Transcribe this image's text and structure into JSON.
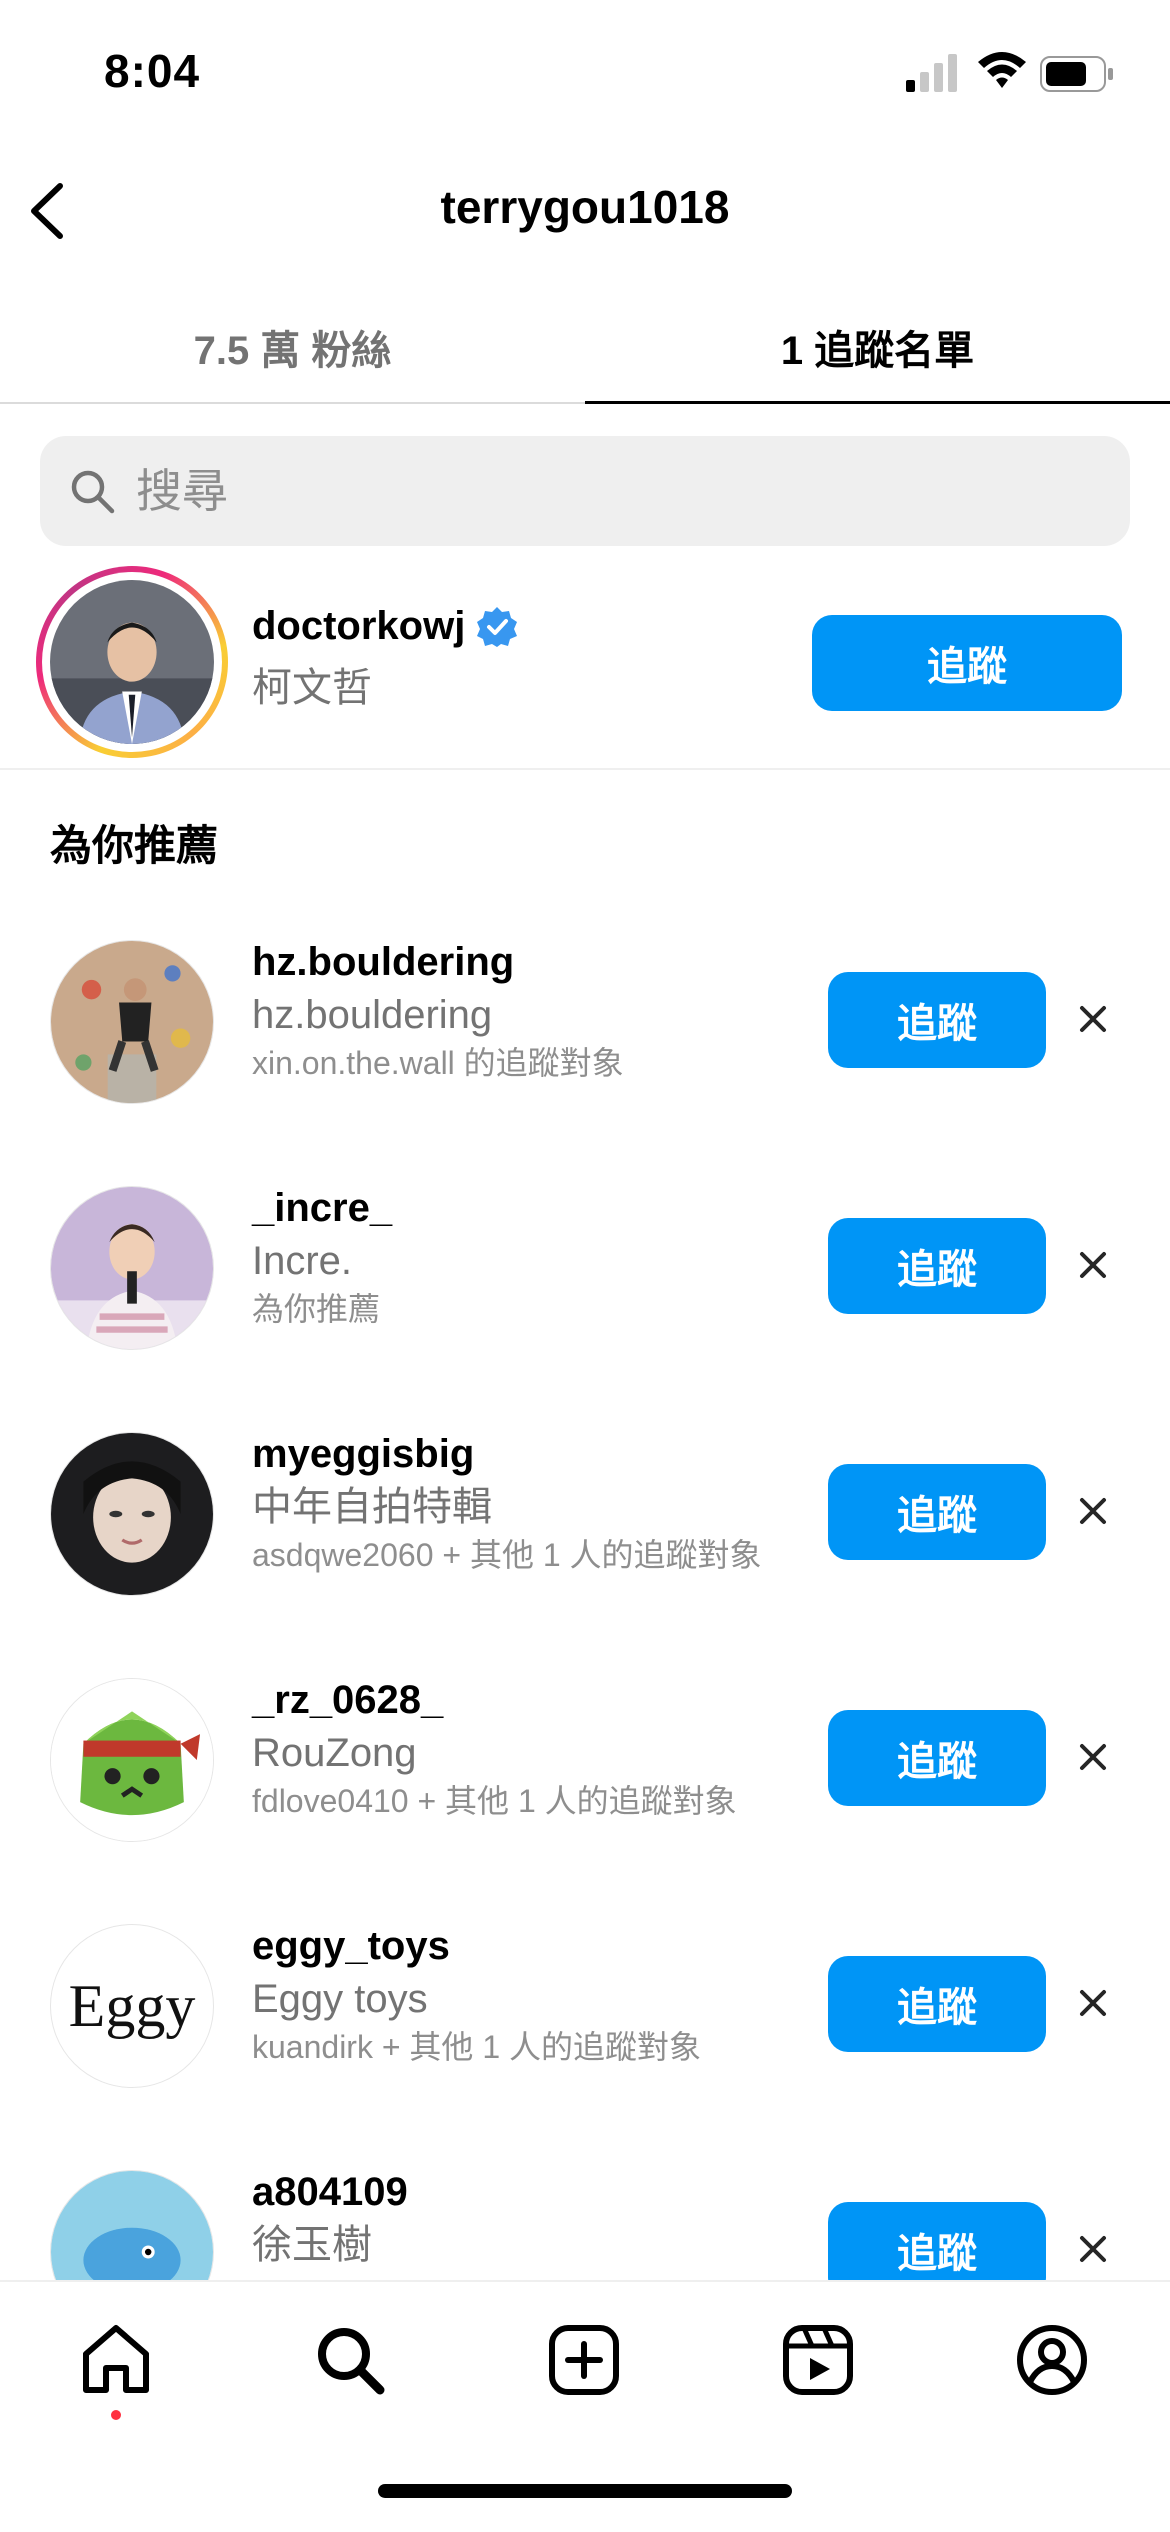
{
  "status_bar": {
    "time": "8:04"
  },
  "header": {
    "title": "terrygou1018"
  },
  "tabs": [
    {
      "label": "7.5 萬 粉絲",
      "active": false
    },
    {
      "label": "1 追蹤名單",
      "active": true
    }
  ],
  "search": {
    "placeholder": "搜尋",
    "value": ""
  },
  "following": {
    "username": "doctorkowj",
    "verified": true,
    "display_name": "柯文哲",
    "button": "追蹤"
  },
  "suggestions_title": "為你推薦",
  "suggestions": [
    {
      "username": "hz.bouldering",
      "display_name": "hz.bouldering",
      "reason": "xin.on.the.wall 的追蹤對象",
      "button": "追蹤"
    },
    {
      "username": "_incre_",
      "display_name": "Incre.",
      "reason": "為你推薦",
      "button": "追蹤"
    },
    {
      "username": "myeggisbig",
      "display_name": "中年自拍特輯",
      "reason": "asdqwe2060 + 其他 1 人的追蹤對象",
      "button": "追蹤"
    },
    {
      "username": "_rz_0628_",
      "display_name": "RouZong",
      "reason": "fdlove0410 + 其他 1 人的追蹤對象",
      "button": "追蹤"
    },
    {
      "username": "eggy_toys",
      "display_name": "Eggy toys",
      "reason": "kuandirk + 其他 1 人的追蹤對象",
      "button": "追蹤",
      "avatar_text": "Eggy"
    },
    {
      "username": "a804109",
      "display_name": "徐玉樹",
      "reason": "",
      "button": "追蹤"
    }
  ],
  "bottom_nav": [
    "home-icon",
    "search-icon",
    "create-icon",
    "reels-icon",
    "profile-icon"
  ],
  "colors": {
    "accent": "#0095f6",
    "secondary_text": "#737373",
    "notification_dot": "#ff3040"
  }
}
